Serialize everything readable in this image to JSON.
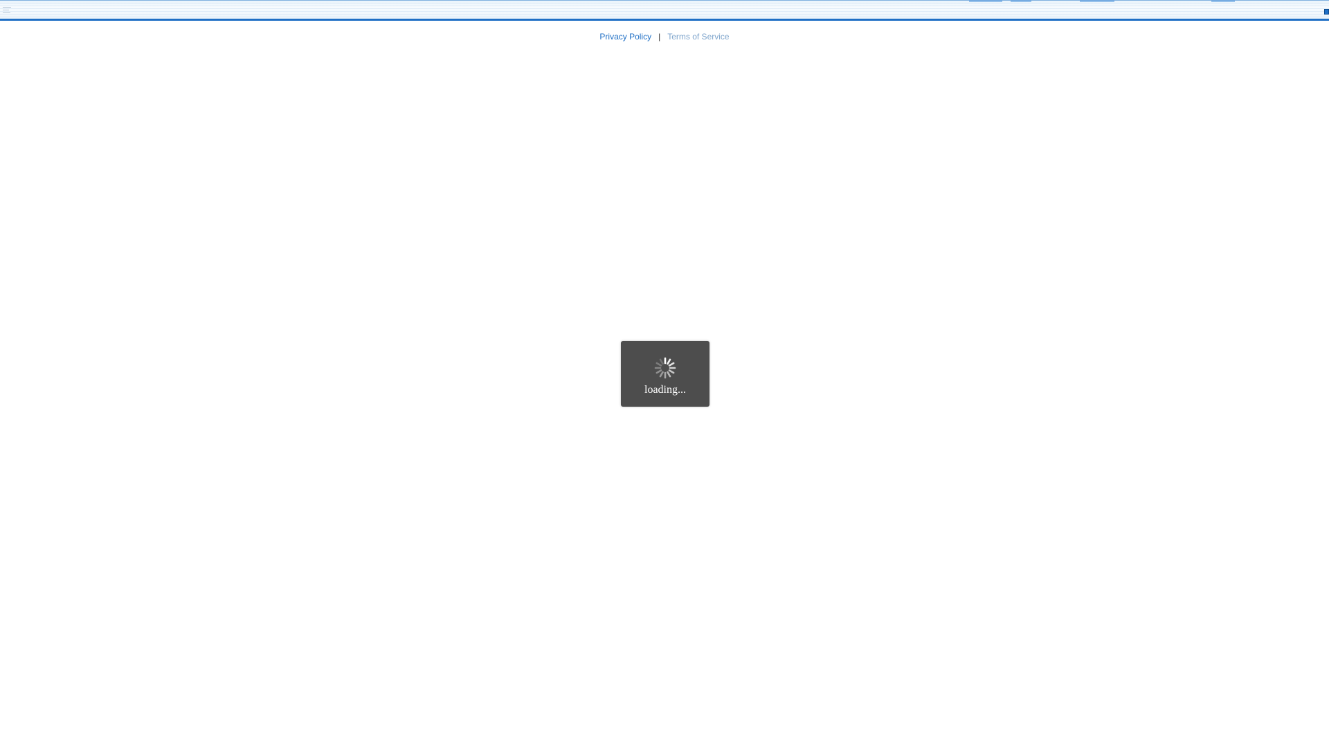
{
  "footer": {
    "privacy_label": "Privacy Policy",
    "separator": "|",
    "terms_label": "Terms of Service"
  },
  "loading": {
    "text": "loading...",
    "icon": "spinner-icon"
  },
  "colors": {
    "accent": "#1f6fc5",
    "link": "#1f6fc5",
    "link_muted": "#7fa5cc",
    "overlay_bg": "#4d4d4d"
  }
}
